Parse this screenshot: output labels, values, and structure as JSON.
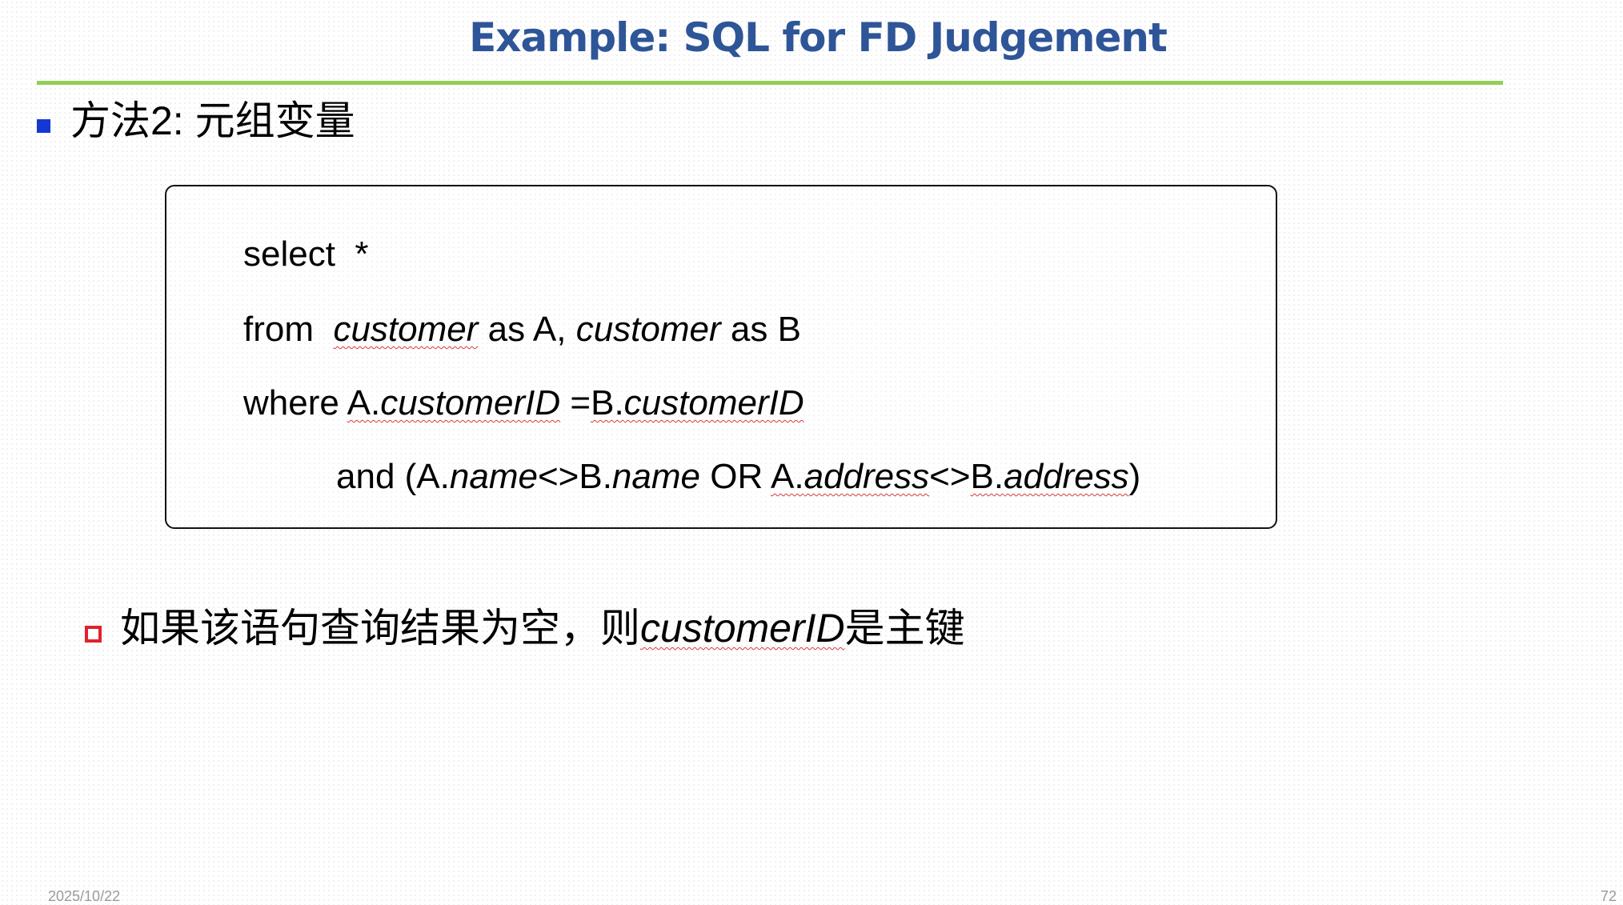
{
  "slide": {
    "title": "Example: SQL for FD Judgement",
    "heading": "方法2: 元组变量",
    "code": {
      "line1": {
        "text": "select  *"
      },
      "line2": {
        "kw_from": "from  ",
        "tbl1": "customer",
        "as1": " as A, ",
        "tbl2": "customer",
        "as2": " as B"
      },
      "line3": {
        "kw_where": "where ",
        "a_prefix": "A.",
        "a_attr": "customerID",
        "eq": " =",
        "b_prefix": "B.",
        "b_attr": "customerID"
      },
      "line4": {
        "kw_and": "and (",
        "a1_prefix": "A.",
        "a1_attr": "name",
        "neq1": "<>",
        "b1_prefix": "B.",
        "b1_attr": "name",
        "or": " OR ",
        "a2_prefix": "A.",
        "a2_attr": "address",
        "neq2": "<>",
        "b2_prefix": "B.",
        "b2_attr": "address",
        "close": ")"
      }
    },
    "note": {
      "prefix": "如果该语句查询结果为空，则",
      "term": "customerID",
      "suffix": "是主键"
    },
    "footer": {
      "date": "2025/10/22",
      "page": "72"
    }
  },
  "colors": {
    "title": "#2e5597",
    "rule": "#92cf55",
    "bullet_level1": "#1438d3",
    "bullet_level2": "#e0222b",
    "spellcheck": "#d43a3a"
  }
}
